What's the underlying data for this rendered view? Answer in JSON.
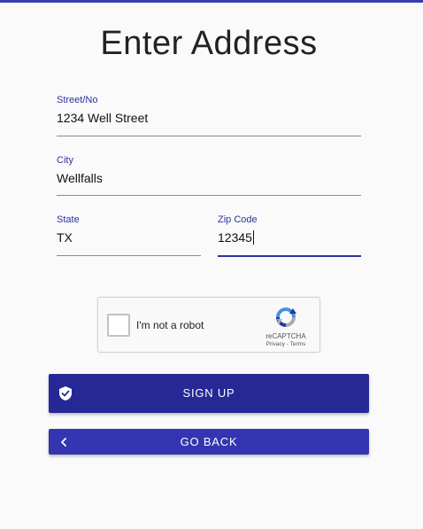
{
  "page": {
    "title": "Enter Address"
  },
  "form": {
    "street": {
      "label": "Street/No",
      "value": "1234 Well Street"
    },
    "city": {
      "label": "City",
      "value": "Wellfalls"
    },
    "state": {
      "label": "State",
      "value": "TX"
    },
    "zip": {
      "label": "Zip Code",
      "value": "12345"
    }
  },
  "captcha": {
    "label": "I'm not a robot",
    "brand": "reCAPTCHA",
    "links": "Privacy - Terms"
  },
  "buttons": {
    "signup": {
      "label": "SIGN UP",
      "icon": "shield-check-icon"
    },
    "back": {
      "label": "GO BACK",
      "icon": "chevron-left-icon"
    }
  },
  "colors": {
    "accent": "#2e32a0",
    "signup_bg": "#262896",
    "back_bg": "#3336b0"
  }
}
